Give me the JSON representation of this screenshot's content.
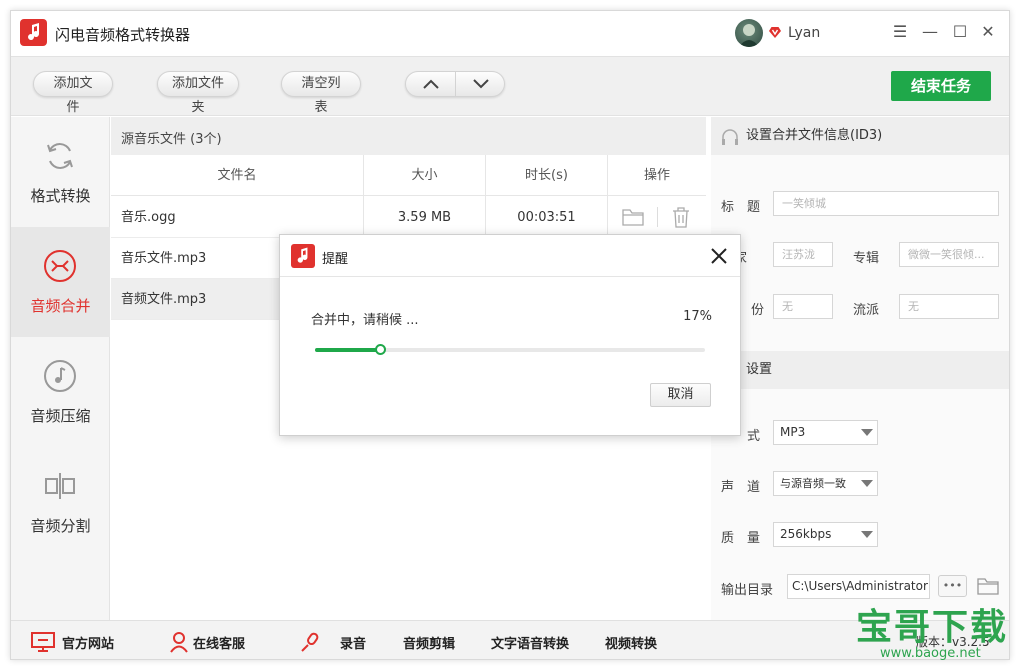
{
  "app": {
    "title": "闪电音频格式转换器",
    "username": "Lyan"
  },
  "window_controls": {
    "menu": "☰",
    "minimize": "—",
    "maximize": "☐",
    "close": "✕"
  },
  "toolbar": {
    "add_file": "添加文件",
    "add_folder": "添加文件夹",
    "clear_list": "清空列表",
    "end_task": "结束任务"
  },
  "sidebar": {
    "items": [
      {
        "label": "格式转换",
        "icon": "refresh-icon",
        "active": false
      },
      {
        "label": "音频合并",
        "icon": "merge-icon",
        "active": true
      },
      {
        "label": "音频压缩",
        "icon": "music-note-icon",
        "active": false
      },
      {
        "label": "音频分割",
        "icon": "split-icon",
        "active": false
      }
    ]
  },
  "file_list": {
    "title": "源音乐文件 (3个)",
    "columns": [
      "文件名",
      "大小",
      "时长(s)",
      "操作"
    ],
    "rows": [
      {
        "name": "音乐.ogg",
        "size": "3.59 MB",
        "duration": "00:03:51"
      },
      {
        "name": "音乐文件.mp3",
        "size": "",
        "duration": ""
      },
      {
        "name": "音频文件.mp3",
        "size": "",
        "duration": ""
      }
    ]
  },
  "id3": {
    "header": "设置合并文件信息(ID3)",
    "title_label": "标　题",
    "title_placeholder": "一笑倾城",
    "artist_label": "术家",
    "artist_placeholder": "汪苏泷",
    "album_label": "专辑",
    "album_placeholder": "微微一笑很倾...",
    "year_label": "份",
    "year_placeholder": "无",
    "genre_label": "流派",
    "genre_placeholder": "无"
  },
  "output": {
    "header": "设置",
    "format_label": "式",
    "format_value": "MP3",
    "channel_label": "声　道",
    "channel_value": "与源音频一致",
    "quality_label": "质　量",
    "quality_value": "256kbps",
    "dir_label": "输出目录",
    "dir_value": "C:\\Users\\Administrator",
    "more_label": "•••"
  },
  "statusbar": {
    "website": "官方网站",
    "support": "在线客服",
    "record": "录音",
    "audio_edit": "音频剪辑",
    "tts": "文字语音转换",
    "video": "视频转换",
    "version": "版本：v3.2.5"
  },
  "dialog": {
    "title": "提醒",
    "message": "合并中，请稍候 ...",
    "percent_text": "17%",
    "progress": 0.17,
    "cancel": "取消"
  },
  "watermark": {
    "main": "宝哥下载",
    "url": "www.baoge.net"
  },
  "colors": {
    "accent": "#e0322e",
    "green": "#1fa84a"
  }
}
